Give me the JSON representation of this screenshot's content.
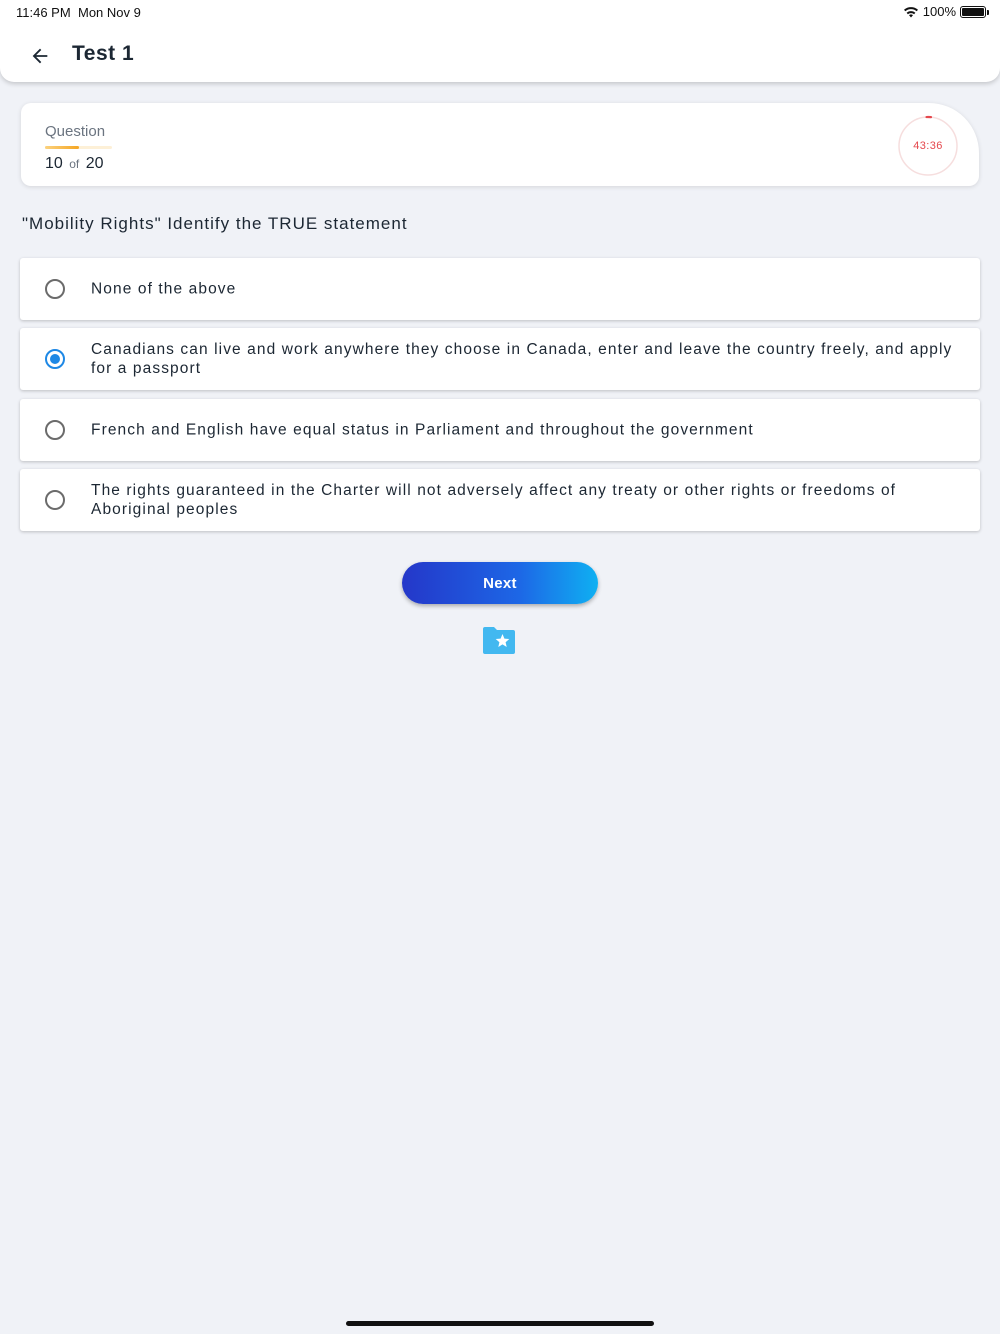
{
  "status_bar": {
    "time": "11:46 PM",
    "date": "Mon Nov 9",
    "battery": "100%"
  },
  "header": {
    "title": "Test 1",
    "back_icon": "arrow-left-icon"
  },
  "question_card": {
    "label": "Question",
    "current": "10",
    "of_text": "of",
    "total": "20",
    "progress_fraction": 0.5,
    "timer": "43:36",
    "timer_color": "#e5484d"
  },
  "question": {
    "text": "\"Mobility Rights\" Identify the TRUE statement",
    "options": [
      {
        "label": "None of the above",
        "selected": false
      },
      {
        "label": "Canadians can live and work anywhere they choose in Canada, enter and leave the country freely, and apply for a passport",
        "selected": true
      },
      {
        "label": "French and English have equal status in Parliament and throughout the government",
        "selected": false
      },
      {
        "label": "The rights guaranteed in the Charter will not adversely affect any treaty or other rights or freedoms of Aboriginal peoples",
        "selected": false
      }
    ]
  },
  "actions": {
    "next_label": "Next",
    "bookmark_icon": "folder-star-icon"
  },
  "colors": {
    "accent": "#1e88e5",
    "background": "#f0f2f7",
    "progress": "#f5a623"
  }
}
